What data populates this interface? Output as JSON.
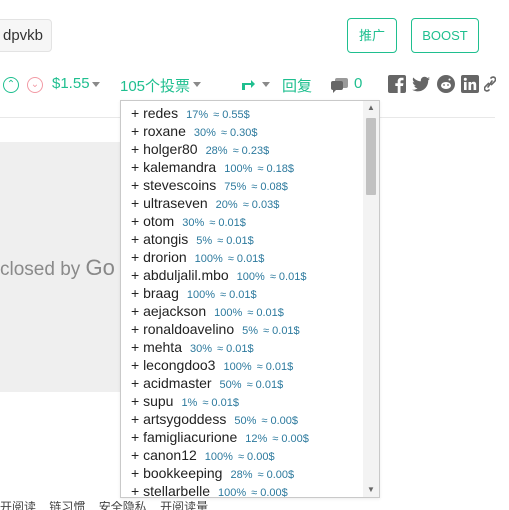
{
  "tag": {
    "label": "dpvkb"
  },
  "header_buttons": {
    "promote": "推广",
    "boost": "BOOST"
  },
  "actions": {
    "payout": "$1.55",
    "votes": "105个投票",
    "reply": "回复",
    "comments": "0"
  },
  "video": {
    "text": "closed by ",
    "text_end": "Go"
  },
  "footer": {
    "items": [
      "开阅读",
      "链习惯",
      "安全隐私",
      "开阅读量"
    ]
  },
  "voters": [
    {
      "name": "+ redes",
      "pct": "17%",
      "amt": "≈ 0.55$"
    },
    {
      "name": "+ roxane",
      "pct": "30%",
      "amt": "≈ 0.30$"
    },
    {
      "name": "+ holger80",
      "pct": "28%",
      "amt": "≈ 0.23$"
    },
    {
      "name": "+ kalemandra",
      "pct": "100%",
      "amt": "≈ 0.18$"
    },
    {
      "name": "+ stevescoins",
      "pct": "75%",
      "amt": "≈ 0.08$"
    },
    {
      "name": "+ ultraseven",
      "pct": "20%",
      "amt": "≈ 0.03$"
    },
    {
      "name": "+ otom",
      "pct": "30%",
      "amt": "≈ 0.01$"
    },
    {
      "name": "+ atongis",
      "pct": "5%",
      "amt": "≈ 0.01$"
    },
    {
      "name": "+ drorion",
      "pct": "100%",
      "amt": "≈ 0.01$"
    },
    {
      "name": "+ abduljalil.mbo",
      "pct": "100%",
      "amt": "≈ 0.01$"
    },
    {
      "name": "+ braag",
      "pct": "100%",
      "amt": "≈ 0.01$"
    },
    {
      "name": "+ aejackson",
      "pct": "100%",
      "amt": "≈ 0.01$"
    },
    {
      "name": "+ ronaldoavelino",
      "pct": "5%",
      "amt": "≈ 0.01$"
    },
    {
      "name": "+ mehta",
      "pct": "30%",
      "amt": "≈ 0.01$"
    },
    {
      "name": "+ lecongdoo3",
      "pct": "100%",
      "amt": "≈ 0.01$"
    },
    {
      "name": "+ acidmaster",
      "pct": "50%",
      "amt": "≈ 0.01$"
    },
    {
      "name": "+ supu",
      "pct": "1%",
      "amt": "≈ 0.01$"
    },
    {
      "name": "+ artsygoddess",
      "pct": "50%",
      "amt": "≈ 0.00$"
    },
    {
      "name": "+ famigliacurione",
      "pct": "12%",
      "amt": "≈ 0.00$"
    },
    {
      "name": "+ canon12",
      "pct": "100%",
      "amt": "≈ 0.00$"
    },
    {
      "name": "+ bookkeeping",
      "pct": "28%",
      "amt": "≈ 0.00$"
    },
    {
      "name": "+ stellarbelle",
      "pct": "100%",
      "amt": "≈ 0.00$"
    }
  ],
  "colors": {
    "accent": "#1fbf8f",
    "downvote": "#f29aa5",
    "vote_meta": "#2d7a9e"
  },
  "icons": {
    "upvote": "chevron-up-circle-icon",
    "downvote": "chevron-down-circle-icon",
    "resteem": "resteem-icon",
    "comment": "comment-icon",
    "facebook": "facebook-icon",
    "twitter": "twitter-icon",
    "reddit": "reddit-icon",
    "linkedin": "linkedin-icon",
    "link": "link-icon"
  }
}
